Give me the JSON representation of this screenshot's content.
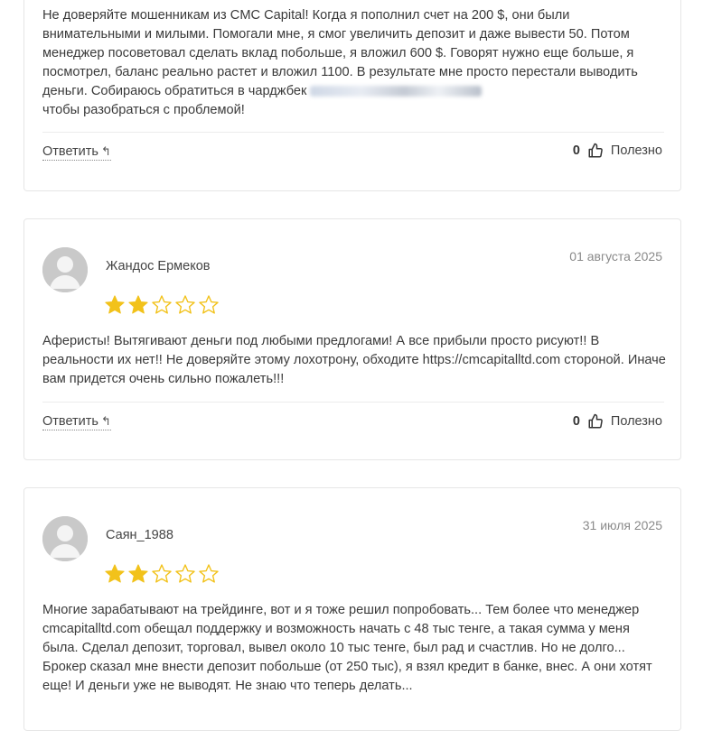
{
  "reviews": [
    {
      "text_before": "Не доверяйте мошенникам из CMC Capital! Когда я пополнил счет на 200 $, они были внимательными и милыми. Помогали мне, я смог увеличить депозит и даже вывести 50. Потом менеджер посоветовал сделать вклад побольше, я вложил 600 $. Говорят нужно еще больше, я посмотрел, баланс реально растет и вложил 1100. В результате мне просто перестали выводить деньги. Собираюсь обратиться в чарджбек",
      "text_after": "чтобы разобраться с проблемой!",
      "reply_label": "Ответить",
      "likes": "0",
      "helpful_label": "Полезно"
    },
    {
      "author": "Жандос Ермеков",
      "date": "01 августа 2025",
      "rating": 2,
      "text": "Аферисты! Вытягивают деньги под любыми предлогами! А все прибыли просто рисуют!! В реальности их нет!! Не доверяйте этому лохотрону, обходите https://cmcapitalltd.com стороной. Иначе вам придется очень сильно пожалеть!!!",
      "reply_label": "Ответить",
      "likes": "0",
      "helpful_label": "Полезно"
    },
    {
      "author": "Саян_1988",
      "date": "31 июля 2025",
      "rating": 2,
      "text": "Многие зарабатывают на трейдинге, вот и я тоже решил попробовать... Тем более что менеджер cmcapitalltd.com обещал поддержку и возможность начать с 48 тыс тенге, а такая сумма у меня была. Сделал депозит, торговал, вывел около 10 тыс тенге, был рад и счастлив. Но не долго... Брокер сказал мне внести депозит побольше (от 250 тыс), я взял кредит в банке, внес. А они хотят еще! И деньги уже не выводят. Не знаю что теперь делать..."
    }
  ],
  "colors": {
    "star": "#f2c21b",
    "star_empty": "#f2c21b",
    "avatar": "#c9c9c9"
  },
  "icons": {
    "reply": "reply-arrow-icon",
    "like": "thumbs-up-icon",
    "avatar": "user-silhouette-icon",
    "star": "star-icon"
  }
}
